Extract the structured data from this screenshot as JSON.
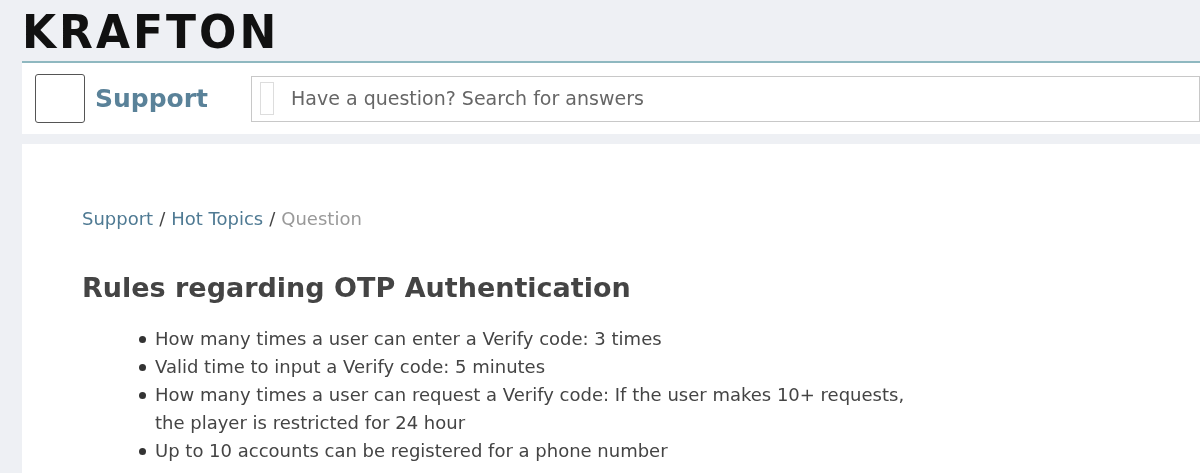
{
  "logo": {
    "text": "KRAFTON"
  },
  "header": {
    "title": "Support",
    "search": {
      "placeholder": "Have a question? Search for answers"
    }
  },
  "breadcrumb_separator": "/",
  "breadcrumb": [
    {
      "label": "Support",
      "kind": "link"
    },
    {
      "label": "Hot Topics",
      "kind": "link"
    },
    {
      "label": "Question",
      "kind": "current"
    }
  ],
  "article": {
    "title": "Rules regarding OTP Authentication",
    "bullets": [
      "How many times a user can enter a Verify code: 3 times",
      "Valid time to input a Verify code: 5 minutes",
      "How many times a user can request a Verify code: If the user makes 10+ requests, the player is restricted for 24 hour",
      "Up to 10 accounts can be registered for a phone number"
    ]
  }
}
